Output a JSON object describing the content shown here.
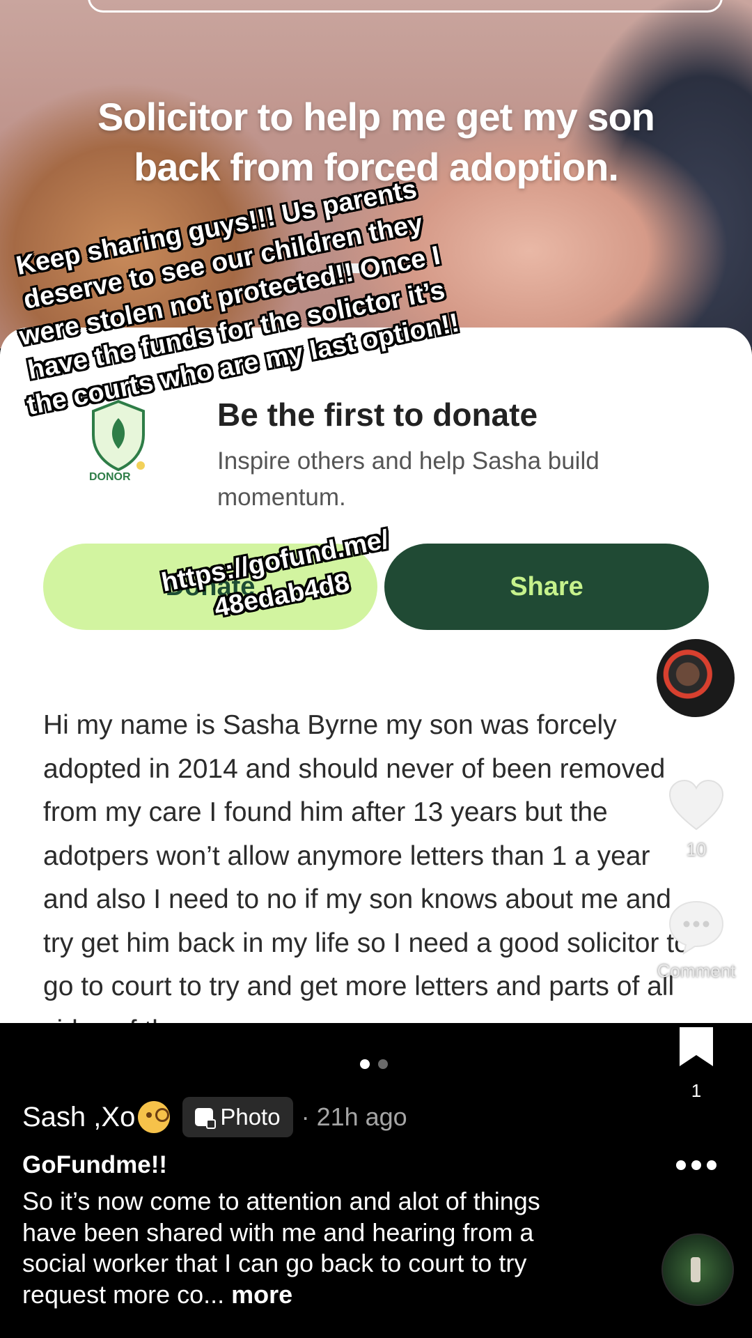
{
  "campaign": {
    "hero_title": "Solicitor to help me get my son back from forced adoption.",
    "first_title": "Be the first to donate",
    "first_subtitle": "Inspire others and help Sasha build momentum.",
    "badge_text": "DONOR",
    "donate_label": "Donate",
    "share_label": "Share",
    "story": "Hi my name is Sasha Byrne my son was forcely adopted in 2014 and should never of been removed from my care I found him after 13 years but the adotpers won’t allow anymore letters than 1 a year and also I need to no if my son knows about me and try get him back in my life so I need a good solicitor to go to court to try and get more letters and parts of all sides of the"
  },
  "overlay": {
    "caption": "Keep sharing guys!!! Us parents deserve to see our children they were stolen not protected!! Once I have the funds for the solictor it’s the courts who are my last option!!",
    "url": "https://gofund.me/ 48edab4d8"
  },
  "rail": {
    "like_count": "10",
    "comment_label": "Comment",
    "save_count": "1"
  },
  "post": {
    "author": "Sash ,Xo",
    "type_label": "Photo",
    "time": "· 21h ago",
    "title": "GoFundme!!",
    "body": "So it’s now come to attention and alot of things have been shared with me and hearing from a social worker that I can go back to court to try request more co...",
    "more_label": "more",
    "page_indicator": {
      "current": 1,
      "total": 2
    }
  },
  "colors": {
    "donate_bg": "#d2f4a0",
    "share_bg": "#204a34",
    "share_text": "#c6f28c"
  }
}
